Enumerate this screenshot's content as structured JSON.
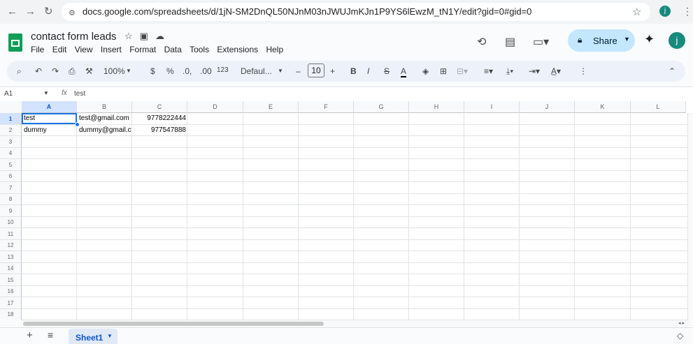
{
  "browser": {
    "back_icon": "arrow-left-icon",
    "forward_icon": "arrow-right-icon",
    "reload_icon": "reload-icon",
    "url": "docs.google.com/spreadsheets/d/1jN-SM2DnQL50NJnM03nJWUJmKJn1P9YS6lEwzM_tN1Y/edit?gid=0#gid=0",
    "profile_initial": "j"
  },
  "header": {
    "title": "contact form leads",
    "menu": [
      "File",
      "Edit",
      "View",
      "Insert",
      "Format",
      "Data",
      "Tools",
      "Extensions",
      "Help"
    ],
    "share_label": "Share",
    "avatar_initial": "j"
  },
  "toolbar": {
    "zoom": "100%",
    "currency": "$",
    "percent": "%",
    "dec_decrease": ".0,",
    "dec_increase": ".00",
    "format_123": "123",
    "font": "Defaul...",
    "font_size": "10",
    "minus": "–",
    "plus": "+",
    "bold": "B",
    "italic": "I",
    "strike": "S",
    "text_color": "A"
  },
  "formula_bar": {
    "name_box": "A1",
    "fx": "fx",
    "value": "test"
  },
  "grid": {
    "columns": [
      "A",
      "B",
      "C",
      "D",
      "E",
      "F",
      "G",
      "H",
      "I",
      "J",
      "K",
      "L"
    ],
    "rows": [
      "1",
      "2",
      "3",
      "4",
      "5",
      "6",
      "7",
      "8",
      "9",
      "10",
      "11",
      "12",
      "13",
      "14",
      "15",
      "16",
      "17",
      "18"
    ],
    "cells": {
      "A1": "test",
      "B1": "test@gmail.com",
      "C1": "9778222444",
      "A2": "dummy",
      "B2": "dummy@gmail.c",
      "C2": "977547888"
    },
    "selected_cell": "A1"
  },
  "sheets": {
    "tabs": [
      "Sheet1"
    ],
    "active": "Sheet1"
  },
  "colors": {
    "accent": "#1a73e8",
    "share_bg": "#c2e7ff",
    "sheets_green": "#0f9d58"
  }
}
